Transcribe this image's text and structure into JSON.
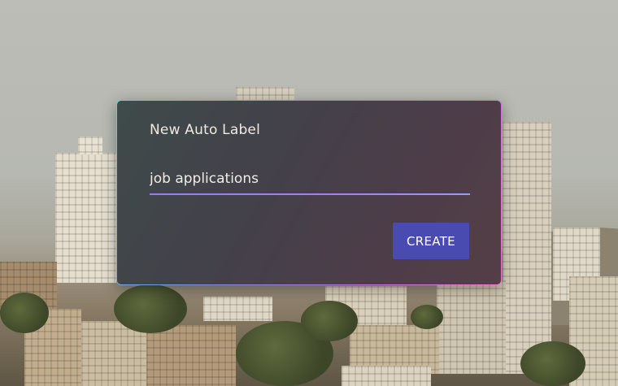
{
  "dialog": {
    "title": "New Auto Label",
    "input_value": "job applications",
    "create_label": "CREATE"
  },
  "colors": {
    "button": "#4a4bb0",
    "dialog_bg": "#3a3430",
    "underline": "#a583e8",
    "border_gradient_start": "#5ad0e8",
    "border_gradient_end": "#f07ad0"
  }
}
